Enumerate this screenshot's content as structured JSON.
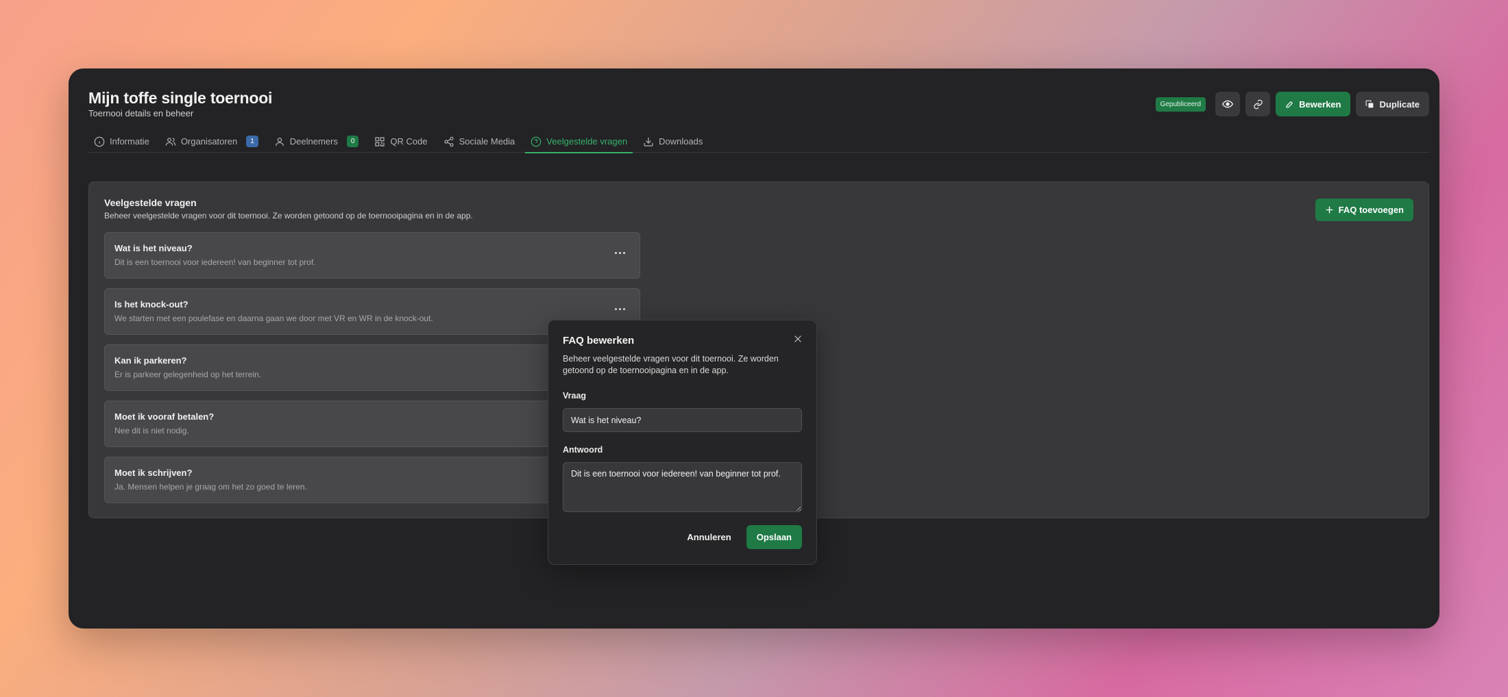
{
  "page": {
    "title": "Mijn toffe single toernooi",
    "subtitle": "Toernooi details en beheer"
  },
  "header": {
    "status_badge": "Gepubliceerd",
    "preview_icon": "eye-icon",
    "link_icon": "link-icon",
    "edit_label": "Bewerken",
    "duplicate_label": "Duplicate"
  },
  "tabs": [
    {
      "label": "Informatie",
      "icon": "info-icon"
    },
    {
      "label": "Organisatoren",
      "icon": "users-icon",
      "count": "1"
    },
    {
      "label": "Deelnemers",
      "icon": "user-icon",
      "count": "0"
    },
    {
      "label": "QR Code",
      "icon": "qr-code-icon"
    },
    {
      "label": "Sociale Media",
      "icon": "share-icon"
    },
    {
      "label": "Veelgestelde vragen",
      "icon": "help-circle-icon",
      "active": true
    },
    {
      "label": "Downloads",
      "icon": "download-icon"
    }
  ],
  "faq_section": {
    "title": "Veelgestelde vragen",
    "description": "Beheer veelgestelde vragen voor dit toernooi. Ze worden getoond op de toernooipagina en in de app.",
    "add_label": "FAQ toevoegen",
    "items": [
      {
        "question": "Wat is het niveau?",
        "answer": "Dit is een toernooi voor iedereen! van beginner tot prof."
      },
      {
        "question": "Is het knock-out?",
        "answer": "We starten met een poulefase en daarna gaan we door met VR en WR in de knock-out."
      },
      {
        "question": "Kan ik parkeren?",
        "answer": "Er is parkeer gelegenheid op het terrein."
      },
      {
        "question": "Moet ik vooraf betalen?",
        "answer": "Nee dit is niet nodig."
      },
      {
        "question": "Moet ik schrijven?",
        "answer": "Ja. Mensen helpen je graag om het zo goed te leren."
      }
    ]
  },
  "modal": {
    "title": "FAQ bewerken",
    "description": "Beheer veelgestelde vragen voor dit toernooi. Ze worden getoond op de toernooipagina en in de app.",
    "question_label": "Vraag",
    "question_value": "Wat is het niveau?",
    "answer_label": "Antwoord",
    "answer_value": "Dit is een toernooi voor iedereen! van beginner tot prof.",
    "cancel_label": "Annuleren",
    "save_label": "Opslaan"
  },
  "colors": {
    "accent_green": "#1f7a45",
    "active_tab": "#37b26c",
    "badge_blue": "#3c6aa8"
  }
}
